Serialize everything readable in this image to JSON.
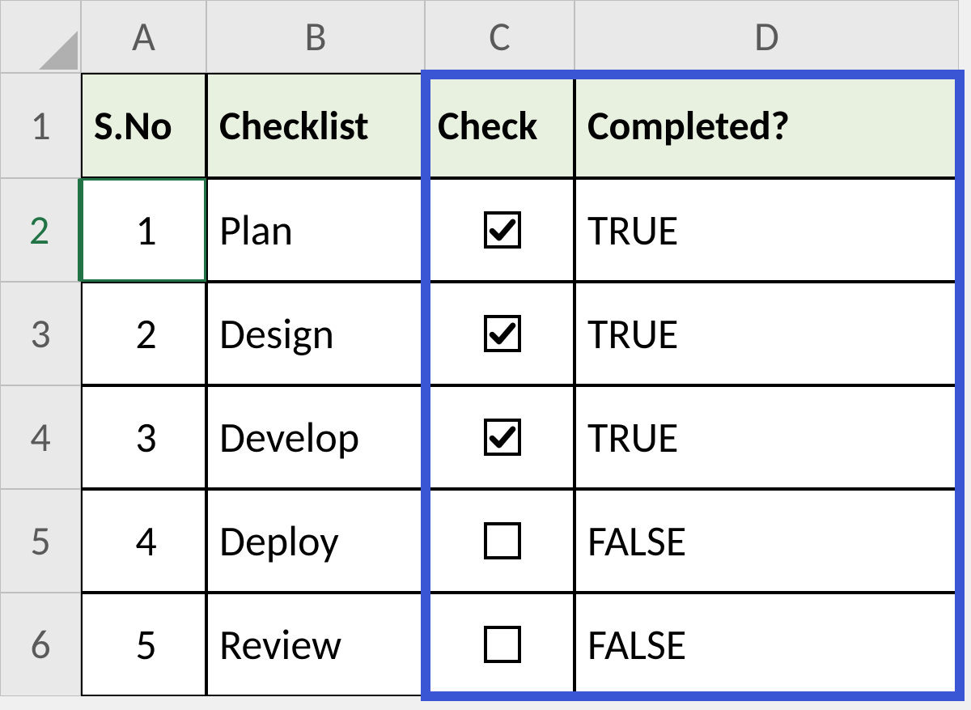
{
  "columns": [
    "A",
    "B",
    "C",
    "D"
  ],
  "row_numbers": [
    "1",
    "2",
    "3",
    "4",
    "5",
    "6"
  ],
  "headers": {
    "sno": "S.No",
    "checklist": "Checklist",
    "check": "Check",
    "completed": "Completed?"
  },
  "rows": [
    {
      "sno": "1",
      "item": "Plan",
      "checked": true,
      "completed": "TRUE"
    },
    {
      "sno": "2",
      "item": "Design",
      "checked": true,
      "completed": "TRUE"
    },
    {
      "sno": "3",
      "item": "Develop",
      "checked": true,
      "completed": "TRUE"
    },
    {
      "sno": "4",
      "item": "Deploy",
      "checked": false,
      "completed": "FALSE"
    },
    {
      "sno": "5",
      "item": "Review",
      "checked": false,
      "completed": "FALSE"
    }
  ],
  "active_cell": "A2",
  "highlight_columns": [
    "C",
    "D"
  ]
}
